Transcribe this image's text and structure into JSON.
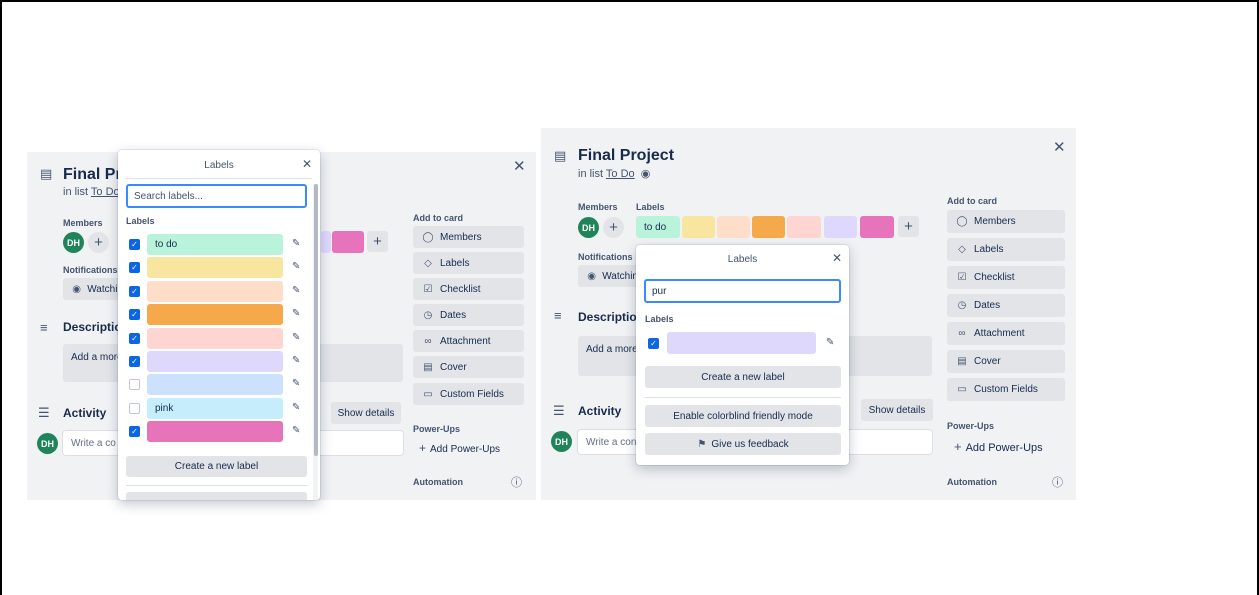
{
  "left": {
    "card": {
      "title": "Final Proj",
      "in_list_prefix": "in list",
      "list_name": "To Do",
      "members_label": "Members",
      "member_initials": "DH",
      "notifications_label": "Notifications",
      "watching_label": "Watchin",
      "description_title": "Description",
      "description_placeholder": "Add a more",
      "activity_title": "Activity",
      "show_details": "Show details",
      "comment_placeholder": "Write a co"
    },
    "sidebar": {
      "add_to_card": "Add to card",
      "buttons": [
        "Members",
        "Labels",
        "Checklist",
        "Dates",
        "Attachment",
        "Cover",
        "Custom Fields"
      ],
      "powerups_label": "Power-Ups",
      "add_powerups": "Add Power-Ups",
      "automation_label": "Automation"
    },
    "popover": {
      "title": "Labels",
      "search_placeholder": "Search labels...",
      "labels_heading": "Labels",
      "labels": [
        {
          "text": "to do",
          "color": "#baf3db",
          "checked": true
        },
        {
          "text": "",
          "color": "#f8e6a0",
          "checked": true
        },
        {
          "text": "",
          "color": "#fedec8",
          "checked": true
        },
        {
          "text": "",
          "color": "#f5a94a",
          "checked": true
        },
        {
          "text": "",
          "color": "#ffd5d2",
          "checked": true
        },
        {
          "text": "",
          "color": "#dfd8fd",
          "checked": true
        },
        {
          "text": "",
          "color": "#cce0ff",
          "checked": false
        },
        {
          "text": "pink",
          "color": "#c6edfb",
          "checked": false
        },
        {
          "text": "",
          "color": "#e774bb",
          "checked": true
        }
      ],
      "create_label": "Create a new label"
    }
  },
  "right": {
    "card": {
      "title": "Final Project",
      "in_list_prefix": "in list",
      "list_name": "To Do",
      "members_label": "Members",
      "labels_label": "Labels",
      "member_initials": "DH",
      "todo_chip": "to do",
      "notifications_label": "Notifications",
      "watching_label": "Watchin",
      "description_title": "Description",
      "description_placeholder": "Add a more",
      "activity_title": "Activity",
      "show_details": "Show details",
      "comment_placeholder": "Write a con"
    },
    "sidebar": {
      "add_to_card": "Add to card",
      "buttons": [
        "Members",
        "Labels",
        "Checklist",
        "Dates",
        "Attachment",
        "Cover",
        "Custom Fields"
      ],
      "powerups_label": "Power-Ups",
      "add_powerups": "Add Power-Ups",
      "automation_label": "Automation"
    },
    "popover": {
      "title": "Labels",
      "search_value": "pur",
      "labels_heading": "Labels",
      "result_color": "#dfd8fd",
      "create_label": "Create a new label",
      "colorblind": "Enable colorblind friendly mode",
      "feedback": "Give us feedback"
    }
  },
  "colors": {
    "todo_green": "#baf3db",
    "yellow": "#f8e6a0",
    "orange_light": "#fedec8",
    "orange": "#f5a94a",
    "red_light": "#ffd5d2",
    "purple_light": "#dfd8fd",
    "pink": "#e774bb",
    "checkbox_blue": "#0c66e4",
    "focus_blue": "#388bff"
  }
}
